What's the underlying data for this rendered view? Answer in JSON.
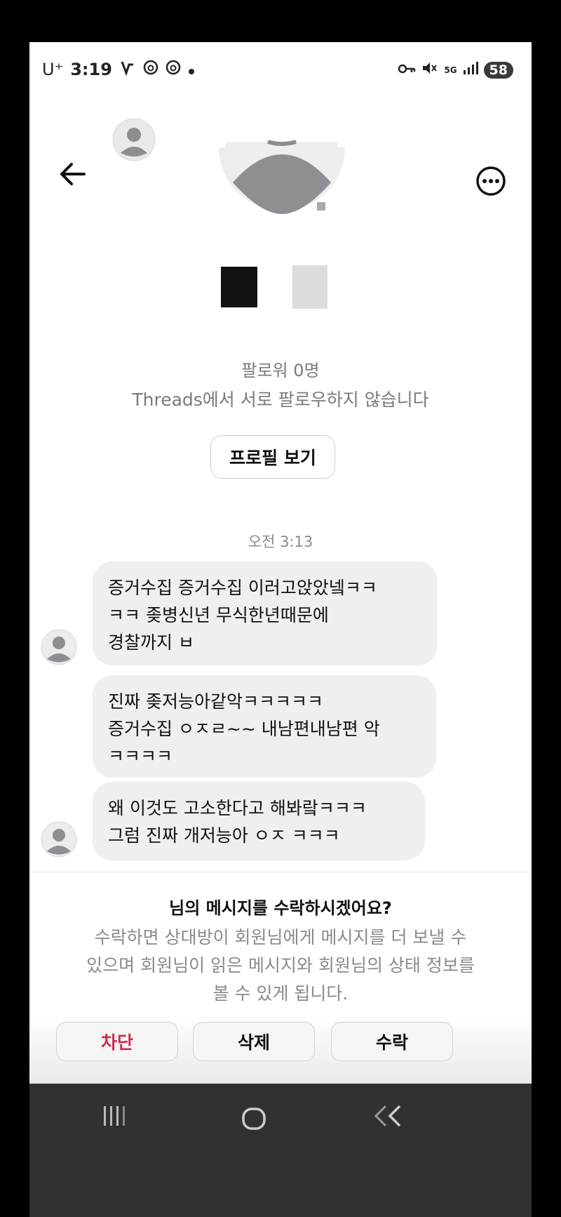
{
  "status_bar": {
    "carrier": "U⁺",
    "time": "3:19",
    "network": "5G",
    "battery": "58",
    "icons": [
      "lightning-icon",
      "threads-icon",
      "threads-icon",
      "dot-icon",
      "key-icon",
      "mute-icon",
      "signal-icon"
    ]
  },
  "header": {
    "back_icon": "arrow-left-icon",
    "more_icon": "more-horizontal-icon"
  },
  "profile": {
    "followers": "팔로워 0명",
    "mutual_status": "Threads에서 서로 팔로우하지 않습니다",
    "view_profile_label": "프로필 보기"
  },
  "thread": {
    "timestamp": "오전 3:13",
    "messages": [
      {
        "lines": [
          "증거수집 증거수집 이러고앉았넼ㅋㅋ",
          "ㅋㅋ 좆병신년 무식한년때문에",
          "경찰까지 ㅂ"
        ]
      },
      {
        "lines": [
          "진짜 좆저능아같악ㅋㅋㅋㅋㅋ",
          "증거수집 ㅇㅈㄹ~~ 내남편내남편 악",
          "ㅋㅋㅋㅋ"
        ]
      },
      {
        "lines": [
          "왜 이것도 고소한다고 해봐랔ㅋㅋㅋ",
          "그럼 진짜 개저능아 ㅇㅈ ㅋㅋㅋ"
        ]
      }
    ]
  },
  "request": {
    "prompt": "님의 메시지를 수락하시겠어요?",
    "description_lines": [
      "수락하면 상대방이 회원님에게 메시지를 더 보낼 수",
      "있으며 회원님이 읽은 메시지와 회원님의 상태 정보를",
      "볼 수 있게 됩니다."
    ],
    "block_label": "차단",
    "delete_label": "삭제",
    "accept_label": "수락",
    "colors": {
      "block": "#d0284a"
    }
  },
  "nav_bar": {
    "icons": [
      "recent-apps-icon",
      "home-icon",
      "back-icon"
    ]
  }
}
